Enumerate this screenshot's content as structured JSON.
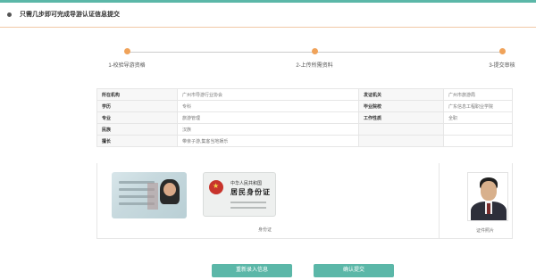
{
  "header": {
    "title": "只需几步即可完成导游认证信息提交"
  },
  "steps": [
    {
      "label": "1-校验导游资格"
    },
    {
      "label": "2-上传所需资料"
    },
    {
      "label": "3-提交审核"
    }
  ],
  "info": {
    "rows": [
      {
        "k1": "所在机构",
        "v1": "广州市导游行业协会",
        "k2": "发证机关",
        "v2": "广州市旅游局"
      },
      {
        "k1": "学历",
        "v1": "专科",
        "k2": "毕业院校",
        "v2": "广东信息工程职业学院"
      },
      {
        "k1": "专业",
        "v1": "旅游管理",
        "k2": "工作性质",
        "v2": "全职"
      },
      {
        "k1": "民族",
        "v1": "汉族",
        "k2": "",
        "v2": ""
      },
      {
        "k1": "擅长",
        "v1": "带亲子游,集客当地娱乐",
        "k2": "",
        "v2": ""
      }
    ]
  },
  "id_card": {
    "back_title_small": "中华人民共和国",
    "back_title_large": "居民身份证",
    "caption": "身份证"
  },
  "portrait": {
    "caption": "证件照片"
  },
  "buttons": {
    "reenter": "重新录入信息",
    "confirm": "确认提交"
  },
  "colors": {
    "accent": "#5bb7a8",
    "step_dot": "#f0a35a",
    "header_rule": "#f2c9a6"
  }
}
